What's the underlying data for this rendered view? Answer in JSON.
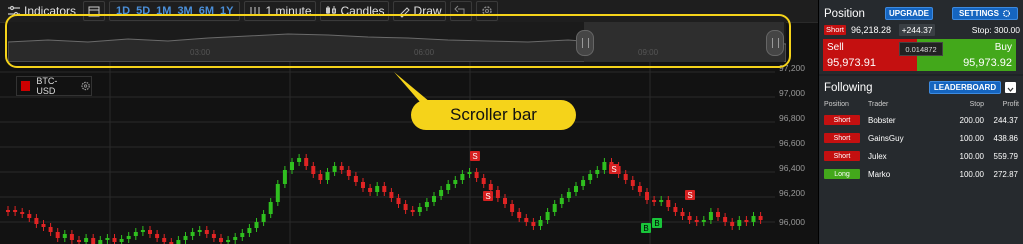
{
  "toolbar": {
    "indicators_label": "Indicators",
    "periods": [
      "1D",
      "5D",
      "1M",
      "3M",
      "6M",
      "1Y"
    ],
    "interval_label": "1 minute",
    "chart_type_label": "Candles",
    "draw_label": "Draw"
  },
  "scroller": {
    "time_labels": [
      "03:00",
      "06:00",
      "09:00"
    ],
    "callout_label": "Scroller bar"
  },
  "symbol": {
    "name": "BTC-USD"
  },
  "price_axis": {
    "labels": [
      "97,200",
      "97,000",
      "96,800",
      "96,600",
      "96,400",
      "96,200",
      "96,000"
    ]
  },
  "markers": [
    {
      "side": "S",
      "color": "#d62020"
    },
    {
      "side": "S",
      "color": "#d62020"
    },
    {
      "side": "S",
      "color": "#d62020"
    },
    {
      "side": "S",
      "color": "#d62020"
    },
    {
      "side": "B",
      "color": "#19c43a"
    },
    {
      "side": "B",
      "color": "#19c43a"
    }
  ],
  "position": {
    "title": "Position",
    "upgrade_label": "UPGRADE",
    "settings_label": "SETTINGS",
    "direction": "Short",
    "entry_price": "96,218.28",
    "pnl": "+244.37",
    "stop_label": "Stop: 300.00"
  },
  "quote": {
    "sell_label": "Sell",
    "sell_price": "95,973.91",
    "buy_label": "Buy",
    "buy_price": "95,973.92",
    "spread": "0.014872"
  },
  "following": {
    "title": "Following",
    "leaderboard_label": "LEADERBOARD",
    "columns": [
      "Position",
      "Trader",
      "Stop",
      "Profit"
    ],
    "rows": [
      {
        "position": "Short",
        "trader": "Bobster",
        "stop": "200.00",
        "profit": "244.37"
      },
      {
        "position": "Short",
        "trader": "GainsGuy",
        "stop": "100.00",
        "profit": "438.86"
      },
      {
        "position": "Short",
        "trader": "Julex",
        "stop": "100.00",
        "profit": "559.79"
      },
      {
        "position": "Long",
        "trader": "Marko",
        "stop": "100.00",
        "profit": "272.87"
      }
    ]
  },
  "colors": {
    "short": "#c41010",
    "long": "#43a81b",
    "accent_blue": "#1565c0",
    "callout_yellow": "#f5d31a"
  }
}
